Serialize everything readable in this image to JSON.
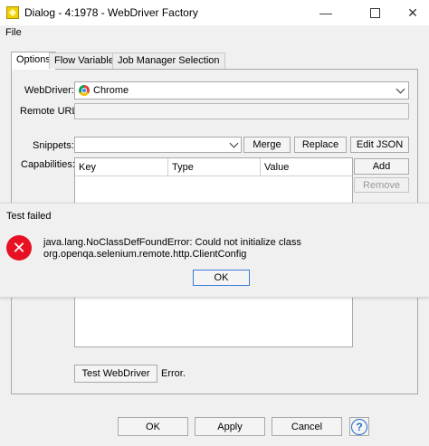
{
  "window": {
    "title": "Dialog - 4:1978 - WebDriver Factory"
  },
  "menu": {
    "file": "File"
  },
  "tabs": [
    "Options",
    "Flow Variables",
    "Job Manager Selection"
  ],
  "options": {
    "webdriver_label": "WebDriver:",
    "webdriver_value": "Chrome",
    "remote_url_label": "Remote URL:",
    "remote_url_value": "",
    "snippets_label": "Snippets:",
    "snippets_value": "",
    "merge": "Merge",
    "replace": "Replace",
    "edit_json": "Edit JSON",
    "capabilities_label": "Capabilities:",
    "columns": [
      "Key",
      "Type",
      "Value"
    ],
    "add": "Add",
    "remove": "Remove",
    "test_button": "Test WebDriver",
    "test_status": "Error."
  },
  "error_dialog": {
    "title": "Test failed",
    "message_line1": "java.lang.NoClassDefFoundError: Could not initialize class",
    "message_line2": "org.openqa.selenium.remote.http.ClientConfig",
    "ok": "OK"
  },
  "footer": {
    "ok": "OK",
    "apply": "Apply",
    "cancel": "Cancel",
    "help": "?"
  },
  "colors": {
    "error_red": "#e81123",
    "focus_blue": "#3b7bd8",
    "help_blue": "#1f6fc8"
  }
}
